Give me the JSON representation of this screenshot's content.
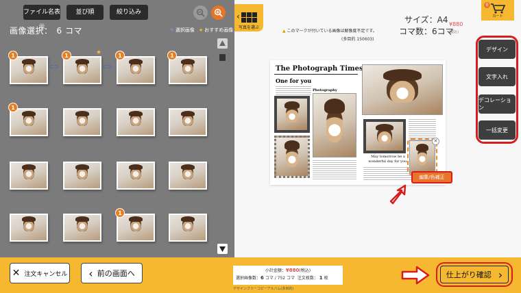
{
  "toolbar": {
    "filename_label": "ファイル名表示",
    "sort_label": "並び順",
    "filter_label": "絞り込み"
  },
  "selection": {
    "title": "画像選択：",
    "count": "6 コマ"
  },
  "legend": {
    "used": "選択画像",
    "recommended": "おすすめ画像"
  },
  "thumbnails": [
    {
      "badge": "1",
      "star": false
    },
    {
      "badge": "1",
      "star": true
    },
    {
      "badge": "1",
      "star": false
    },
    {
      "badge": "1",
      "star": false
    },
    {
      "badge": "1",
      "star": false
    },
    {
      "badge": "",
      "star": false
    },
    {
      "badge": "",
      "star": false
    },
    {
      "badge": "",
      "star": false
    },
    {
      "badge": "",
      "star": false
    },
    {
      "badge": "",
      "star": false
    },
    {
      "badge": "",
      "star": false
    },
    {
      "badge": "",
      "star": false
    },
    {
      "badge": "",
      "star": false
    },
    {
      "badge": "",
      "star": false
    },
    {
      "badge": "1",
      "star": false
    },
    {
      "badge": "",
      "star": false
    }
  ],
  "preview": {
    "back_label": "写真を選ぶ",
    "warning_note": "このマークが付いている画像は解像度不足です。",
    "sub_note": "(多目的 150603)",
    "size_label": "サイズ：A4",
    "pages_label": "コマ数：6コマ",
    "price": "¥880",
    "price_tax": "(税込)",
    "cart_label": "カート",
    "cart_count": "0",
    "newspaper": {
      "title": "The Photograph Times",
      "headline": "One for you",
      "section": "Photography",
      "caption": "May tomorrow be a wonderful day for you."
    },
    "edit_label": "編集/色補正"
  },
  "side_menu": [
    {
      "label": "デザイン"
    },
    {
      "label": "文字入れ"
    },
    {
      "label": "デコレーション"
    },
    {
      "label": "一括変更"
    }
  ],
  "bottom": {
    "cancel_label": "注文キャンセル",
    "prev_label": "前の画面へ",
    "subtotal_label": "小計金額：",
    "subtotal_amount": "¥880",
    "subtotal_tax": "(税込)",
    "selected_label": "選択画像数：",
    "selected_value": "6",
    "selected_total": "コマ / 752 コマ",
    "order_label": "注文枚数：",
    "order_value": "1",
    "order_unit": "枚",
    "footer_note": "デザインフリーコピーアルバム(多目的)",
    "finish_label": "仕上がり確認"
  },
  "colors": {
    "accent": "#f5b830",
    "highlight": "#d81b1b",
    "badge": "#e67e22",
    "panel": "#7b7b7b"
  }
}
